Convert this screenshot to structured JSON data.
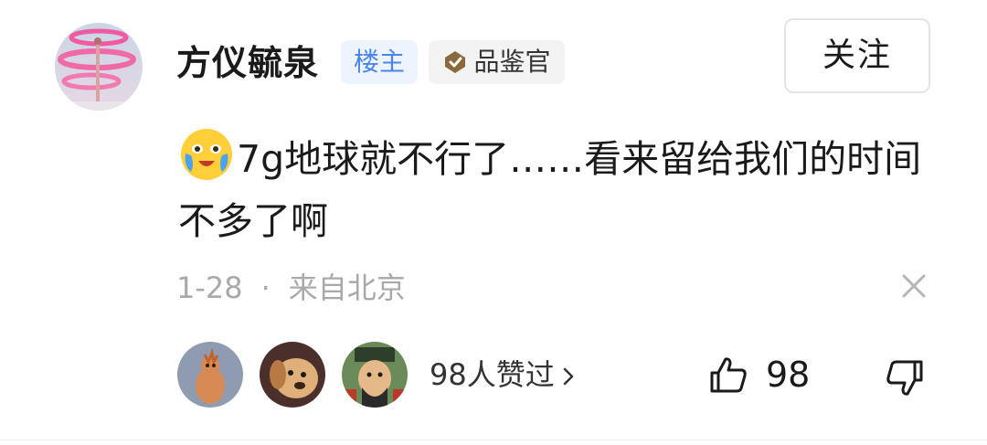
{
  "user": {
    "name": "方仪毓泉",
    "badge_owner": "楼主",
    "badge_title": "品鉴官"
  },
  "follow_button": "关注",
  "comment": {
    "text": "7g地球就不行了……看来留给我们的时间不多了啊",
    "emoji_icon": "crying-laughing-emoji-icon"
  },
  "meta": {
    "date": "1-28",
    "separator": "·",
    "location": "来自北京"
  },
  "likes": {
    "liked_by_text": "98人赞过",
    "count": "98"
  },
  "colors": {
    "owner_badge_bg": "#eef4ff",
    "owner_badge_text": "#4a86e8",
    "meta_text": "#a9a9a9"
  }
}
